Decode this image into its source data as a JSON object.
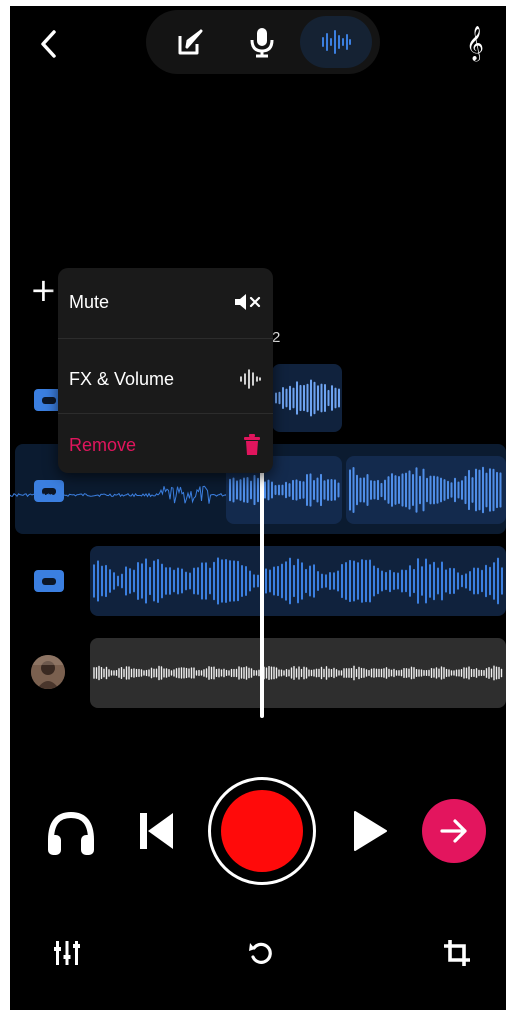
{
  "top_bar": {
    "back_icon": "chevron-left-icon",
    "modes": [
      {
        "name": "lyrics",
        "icon": "pen-note-icon",
        "active": false
      },
      {
        "name": "record",
        "icon": "microphone-icon",
        "active": false
      },
      {
        "name": "tracks",
        "icon": "waveform-icon",
        "active": true
      }
    ],
    "clef_glyph": "𝄞"
  },
  "tracks_area": {
    "add_glyph": "+",
    "marker_label": "2",
    "tracks": [
      {
        "icon": "cassette-icon",
        "color": "#3b7fe0"
      },
      {
        "icon": "cassette-icon",
        "color": "#3b7fe0"
      },
      {
        "icon": "cassette-icon",
        "color": "#3b7fe0"
      },
      {
        "icon": "avatar",
        "color": "#d8d8d8"
      }
    ]
  },
  "context_menu": {
    "items": [
      {
        "label": "Mute",
        "icon": "speaker-mute-icon"
      },
      {
        "label": "FX & Volume",
        "icon": "waveform-small-icon"
      },
      {
        "label": "Remove",
        "icon": "trash-icon",
        "color": "#e0155d"
      }
    ]
  },
  "transport": {
    "icons": [
      "headphones-icon",
      "skip-back-icon",
      "record-button",
      "play-icon",
      "next-arrow-icon"
    ],
    "record_color": "#ff0a0a",
    "next_color": "#e3155e"
  },
  "bottom_bar": {
    "icons": [
      "mixer-icon",
      "undo-icon",
      "crop-icon"
    ]
  },
  "colors": {
    "background": "#000000",
    "clip_blue": "#3b7fe0",
    "clip_bg": "#10223d",
    "accent_pink": "#e3155e"
  }
}
